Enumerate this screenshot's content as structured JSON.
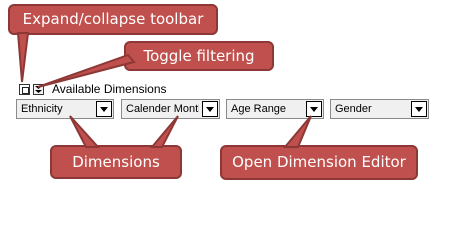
{
  "callouts": {
    "expand_toolbar": "Expand/collapse toolbar",
    "toggle_filtering": "Toggle filtering",
    "dimensions": "Dimensions",
    "open_editor": "Open Dimension Editor"
  },
  "toolbar": {
    "expand_icon": "expand-collapse-icon",
    "filter_icon": "filter-toggle-icon",
    "label": "Available Dimensions"
  },
  "dimensions": [
    {
      "label": "Ethnicity"
    },
    {
      "label": "Calender Month"
    },
    {
      "label": "Age Range"
    },
    {
      "label": "Gender"
    }
  ],
  "colors": {
    "callout_fill": "#c0504d",
    "callout_border": "#8c3836",
    "dimension_fill": "#f0f0f0"
  }
}
